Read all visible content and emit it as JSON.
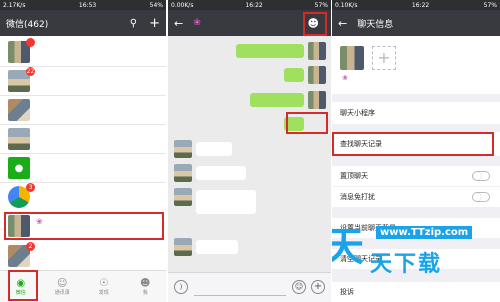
{
  "panel1": {
    "status": {
      "left": "2.17K/s",
      "time": "16:53",
      "battery": "54%"
    },
    "header": {
      "title": "微信(462)",
      "search_icon": "search-icon",
      "plus_icon": "plus-icon"
    },
    "badges": [
      "",
      "22",
      "",
      "3",
      "2"
    ],
    "bottom_nav": [
      {
        "label": "微信",
        "icon": "chat-icon"
      },
      {
        "label": "通讯录",
        "icon": "contacts-icon"
      },
      {
        "label": "发现",
        "icon": "compass-icon"
      },
      {
        "label": "我",
        "icon": "person-icon"
      }
    ]
  },
  "panel2": {
    "status": {
      "left": "0.00K/s",
      "time": "16:22",
      "battery": "57%"
    },
    "header": {
      "back_icon": "back-arrow-icon",
      "person_icon": "person-icon"
    },
    "input_bar": {
      "voice_icon": "voice-icon",
      "emoji_icon": "emoji-icon",
      "plus_icon": "plus-icon"
    }
  },
  "panel3": {
    "status": {
      "left": "0.10K/s",
      "time": "16:22",
      "battery": "57%"
    },
    "header": {
      "title": "聊天信息",
      "back_icon": "back-arrow-icon"
    },
    "cells": {
      "mini_program": "聊天小程序",
      "find_records": "查找聊天记录",
      "pin_chat": "置顶聊天",
      "mute": "消息免打扰",
      "set_bg": "设置当前聊天背景",
      "clear": "清空聊天记录",
      "report": "投诉"
    }
  },
  "watermark": {
    "line1": "天",
    "url": "www.TTzip.com",
    "brand": "天下载"
  },
  "colors": {
    "header": "#393a3f",
    "accent": "#1aad19",
    "highlight": "#d42b2b",
    "bubble": "#9fe05f"
  }
}
